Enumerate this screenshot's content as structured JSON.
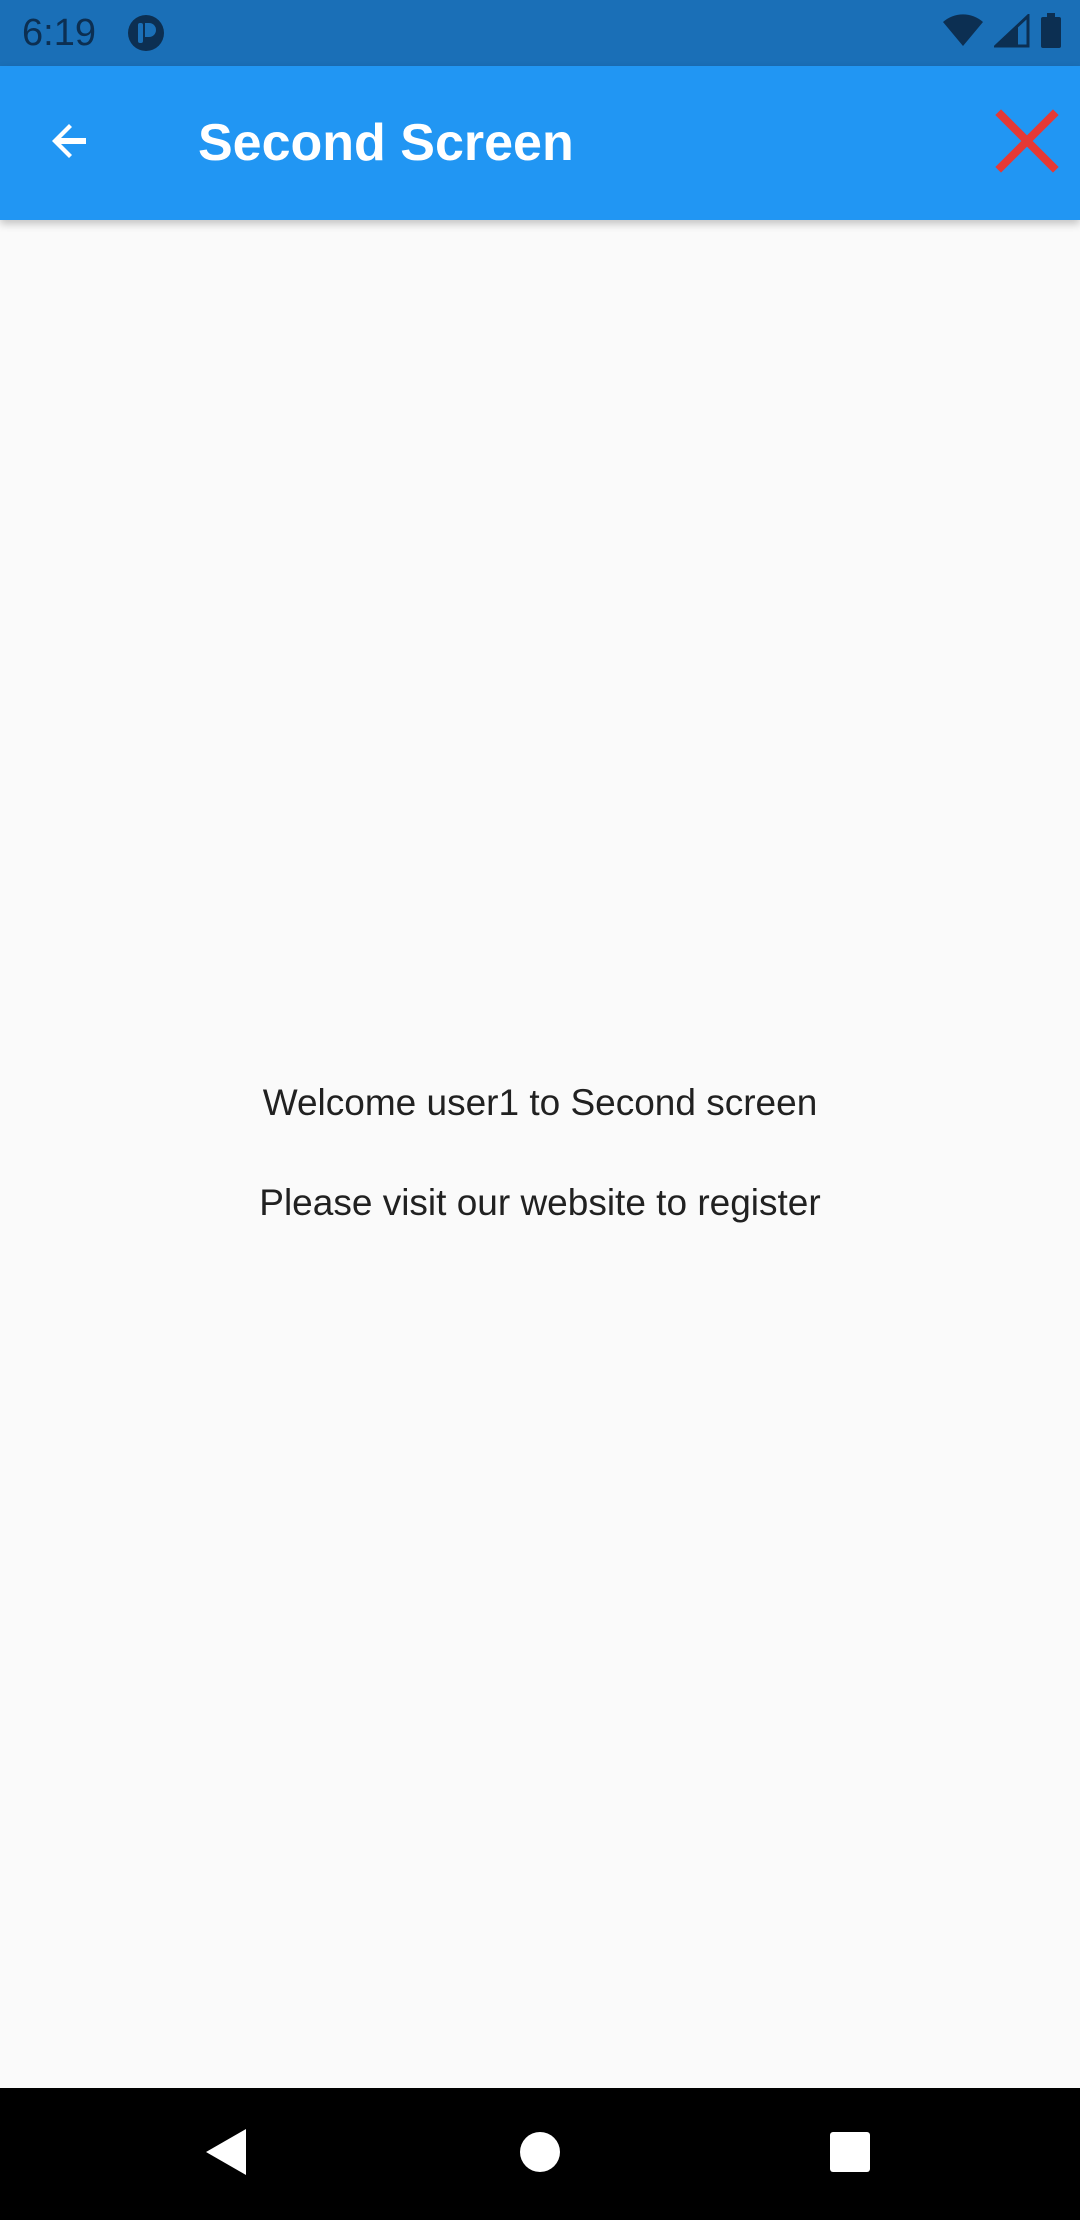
{
  "status_bar": {
    "time": "6:19",
    "icons": [
      "app-notification-icon",
      "wifi-icon",
      "cell-signal-icon",
      "battery-icon"
    ]
  },
  "app_bar": {
    "title": "Second Screen",
    "back_icon": "arrow-back-icon",
    "close_icon": "close-icon",
    "background_color": "#2196f3",
    "close_icon_color": "#e53935"
  },
  "main": {
    "welcome_message": "Welcome user1 to Second screen",
    "register_message": "Please visit our website to register"
  },
  "nav_bar": {
    "buttons": [
      "nav-back-icon",
      "nav-home-icon",
      "nav-recents-icon"
    ]
  }
}
